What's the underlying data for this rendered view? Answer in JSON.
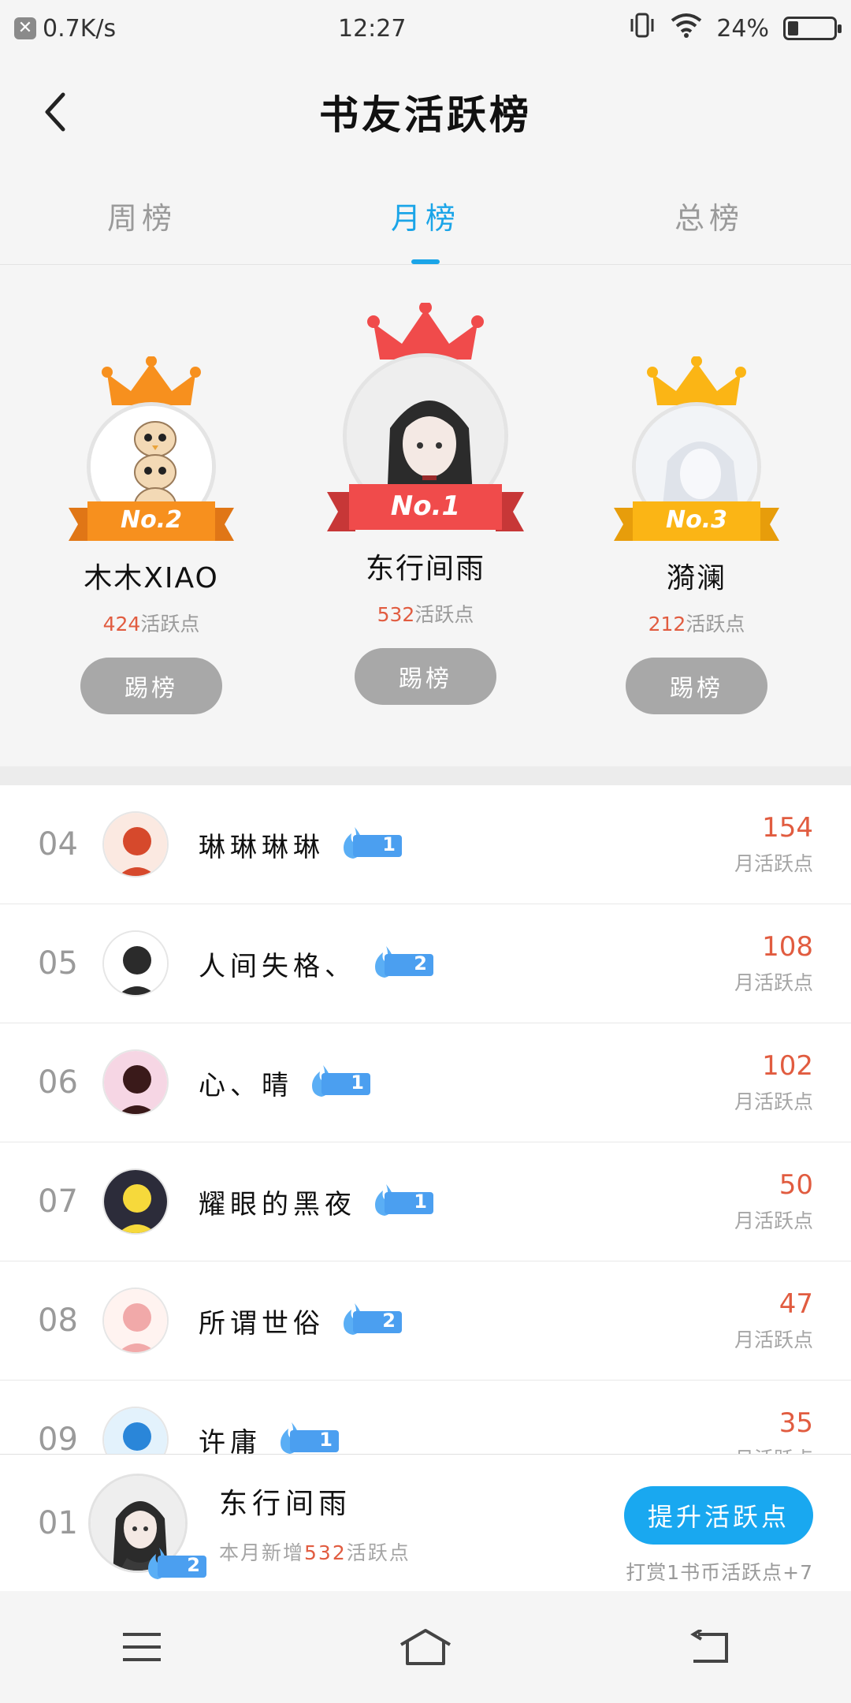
{
  "status_bar": {
    "network_speed": "0.7K/s",
    "time": "12:27",
    "battery_percent": "24%",
    "battery_level": 0.24,
    "icons": [
      "notification-x-icon",
      "vibrate-icon",
      "wifi-icon",
      "battery-icon"
    ]
  },
  "header": {
    "title": "书友活跃榜",
    "back_icon": "chevron-left-icon"
  },
  "tabs": [
    {
      "label": "周榜",
      "active": false
    },
    {
      "label": "月榜",
      "active": true
    },
    {
      "label": "总榜",
      "active": false
    }
  ],
  "podium": [
    {
      "rank_label": "No.2",
      "name": "木木XIAO",
      "points": "424",
      "points_unit": "活跃点",
      "button": "踢榜",
      "crown_color": "#f7901e"
    },
    {
      "rank_label": "No.1",
      "name": "东行间雨",
      "points": "532",
      "points_unit": "活跃点",
      "button": "踢榜",
      "crown_color": "#f04b4b"
    },
    {
      "rank_label": "No.3",
      "name": "漪澜",
      "points": "212",
      "points_unit": "活跃点",
      "button": "踢榜",
      "crown_color": "#fbb515"
    }
  ],
  "list": [
    {
      "rank": "04",
      "name": "琳琳琳琳",
      "level": "1",
      "score": "154",
      "unit": "月活跃点"
    },
    {
      "rank": "05",
      "name": "人间失格、",
      "level": "2",
      "score": "108",
      "unit": "月活跃点"
    },
    {
      "rank": "06",
      "name": "心、晴",
      "level": "1",
      "score": "102",
      "unit": "月活跃点"
    },
    {
      "rank": "07",
      "name": "耀眼的黑夜",
      "level": "1",
      "score": "50",
      "unit": "月活跃点"
    },
    {
      "rank": "08",
      "name": "所谓世俗",
      "level": "2",
      "score": "47",
      "unit": "月活跃点"
    },
    {
      "rank": "09",
      "name": "许庸",
      "level": "1",
      "score": "35",
      "unit": "月活跃点"
    }
  ],
  "my_rank": {
    "rank": "01",
    "name": "东行间雨",
    "level": "2",
    "desc_prefix": "本月新增",
    "desc_value": "532",
    "desc_suffix": "活跃点",
    "button": "提升活跃点",
    "note": "打赏1书币活跃点+7"
  },
  "nav": [
    "menu-icon",
    "home-icon",
    "back-icon"
  ],
  "colors": {
    "accent": "#1ba5e8",
    "score": "#e15c40",
    "badge": "#4b9ff0",
    "muted": "#9a9a9a"
  }
}
